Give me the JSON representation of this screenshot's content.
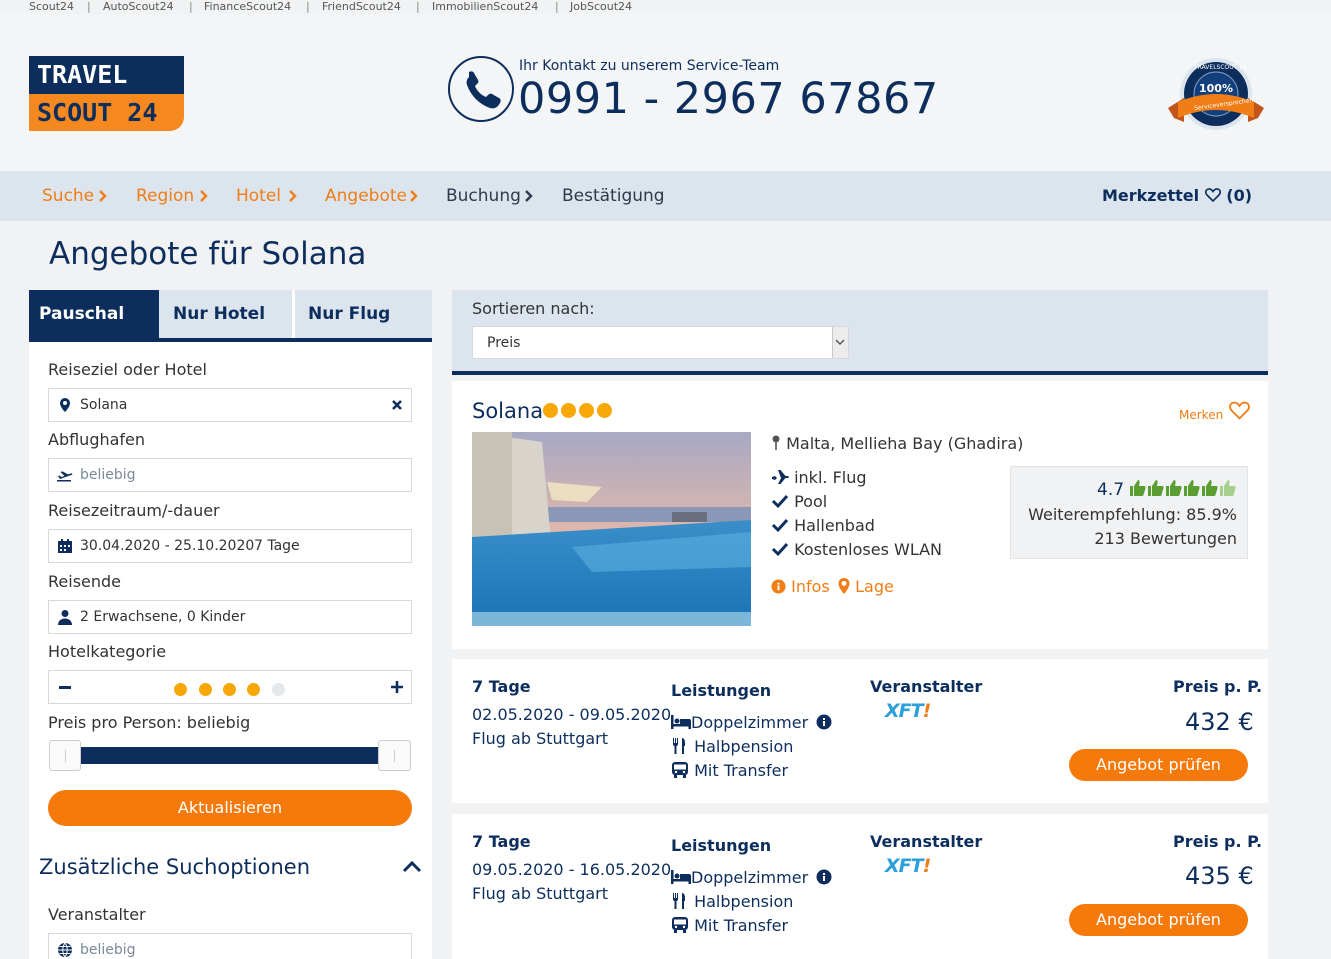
{
  "topbar": {
    "links": [
      "Scout24",
      "AutoScout24",
      "FinanceScout24",
      "FriendScout24",
      "ImmobilienScout24",
      "JobScout24"
    ],
    "separator": "|"
  },
  "header": {
    "logo_line1": "TRAVEL",
    "logo_line2": "SCOUT 24",
    "contact_label": "Ihr Kontakt zu unserem Service-Team",
    "contact_number": "0991 - 2967 67867",
    "seal_percent": "100%",
    "seal_top": "TRAVELSCOUT 24",
    "seal_ribbon": "Serviceversprechen"
  },
  "breadcrumb": {
    "items": [
      "Suche",
      "Region",
      "Hotel",
      "Angebote",
      "Buchung",
      "Bestätigung"
    ],
    "merkzettel_label": "Merkzettel",
    "merkzettel_count": "(0)"
  },
  "page_title": "Angebote für Solana",
  "search": {
    "tabs": [
      "Pauschal",
      "Nur Hotel",
      "Nur Flug"
    ],
    "destination_label": "Reiseziel oder Hotel",
    "destination_value": "Solana",
    "airport_label": "Abflughafen",
    "airport_placeholder": "beliebig",
    "period_label": "Reisezeitraum/-dauer",
    "period_value": "30.04.2020 - 25.10.2020",
    "duration_value": "7 Tage",
    "travellers_label": "Reisende",
    "travellers_value": "2 Erwachsene, 0 Kinder",
    "category_label": "Hotelkategorie",
    "category_selected": 4,
    "category_max": 5,
    "price_label": "Preis pro Person: beliebig",
    "update_button": "Aktualisieren",
    "extra_options_title": "Zusätzliche Suchoptionen",
    "operator_label": "Veranstalter",
    "operator_placeholder": "beliebig"
  },
  "sort": {
    "label": "Sortieren nach:",
    "value": "Preis"
  },
  "hotel": {
    "name": "Solana",
    "stars": 4,
    "merken_label": "Merken",
    "location": "Malta, Mellieha Bay (Ghadira)",
    "features": [
      "inkl. Flug",
      "Pool",
      "Hallenbad",
      "Kostenloses WLAN"
    ],
    "infos_label": "Infos",
    "lage_label": "Lage",
    "rating": "4.7",
    "rating_thumbs": 6,
    "recommendation": "Weiterempfehlung: 85.9%",
    "reviews": "213 Bewertungen"
  },
  "offers": [
    {
      "duration": "7 Tage",
      "dates": "02.05.2020 - 09.05.2020",
      "flight": "Flug ab Stuttgart",
      "services_label": "Leistungen",
      "room": "Doppelzimmer",
      "board": "Halbpension",
      "transfer": "Mit Transfer",
      "operator_label": "Veranstalter",
      "operator_logo": "XFT",
      "operator_logo_mark": "!",
      "price_label": "Preis p. P.",
      "price": "432 €",
      "button": "Angebot prüfen"
    },
    {
      "duration": "7 Tage",
      "dates": "09.05.2020 - 16.05.2020",
      "flight": "Flug ab Stuttgart",
      "services_label": "Leistungen",
      "room": "Doppelzimmer",
      "board": "Halbpension",
      "transfer": "Mit Transfer",
      "operator_label": "Veranstalter",
      "operator_logo": "XFT",
      "operator_logo_mark": "!",
      "price_label": "Preis p. P.",
      "price": "435 €",
      "button": "Angebot prüfen"
    }
  ],
  "colors": {
    "navy": "#0d2e5c",
    "orange": "#f5790b",
    "breadcrumb_bg": "#dce5ee",
    "star": "#f7a707",
    "thumb_green": "#5a9e2f"
  }
}
